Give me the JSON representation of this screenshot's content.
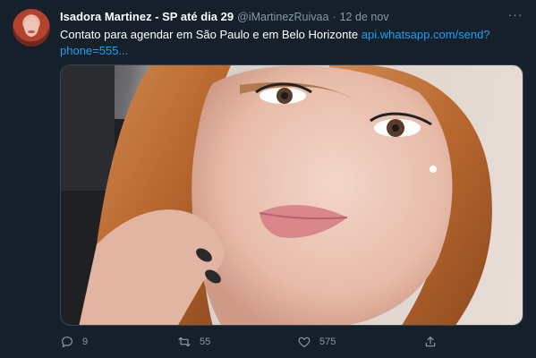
{
  "tweet": {
    "author_name": "Isadora Martinez - SP até dia 29",
    "author_handle": "@iMartinezRuivaa",
    "separator": "·",
    "date": "12 de nov",
    "more_label": "···",
    "text": "Contato para agendar em São Paulo e em Belo Horizonte ",
    "link_text": "api.whatsapp.com/send?phone=555...",
    "counts": {
      "replies": "9",
      "retweets": "55",
      "likes": "575"
    }
  },
  "icons": {
    "more": "more-dots-icon",
    "reply": "reply-icon",
    "retweet": "retweet-icon",
    "like": "heart-icon",
    "share": "share-icon"
  },
  "colors": {
    "background": "#15202b",
    "secondary_text": "#8899a6",
    "link": "#1da1f2",
    "border": "#38444d"
  }
}
